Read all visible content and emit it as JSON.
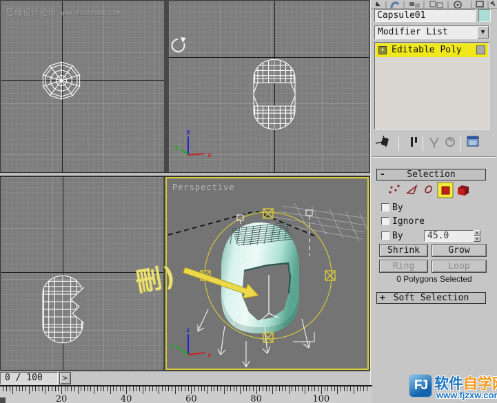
{
  "watermark": {
    "title": "思缘设计论坛",
    "url": "WWW.MISSYUAN.COM"
  },
  "viewports": {
    "perspective_label": "Perspective",
    "annotation": "刪)",
    "axis_labels": {
      "x": "x",
      "y": "y",
      "z": "z"
    }
  },
  "command_panel": {
    "object_name": "Capsule01",
    "object_color": "#a9ddd5",
    "modifier_dropdown": "Modifier List",
    "stack_item": "Editable Poly",
    "stack_expand_glyph": "+",
    "selection_rollout": {
      "title": "Selection",
      "collapse_glyph": "-",
      "sub_object_modes": [
        "vertex",
        "edge",
        "border",
        "polygon",
        "element"
      ],
      "active_mode": "polygon",
      "checkbox_by_vertex": "By",
      "checkbox_ignore": "Ignore",
      "checkbox_by_angle": "By",
      "angle_value": "45.0",
      "shrink": "Shrink",
      "grow": "Grow",
      "ring": "Ring",
      "loop": "Loop",
      "status": "0 Polygons Selected"
    },
    "soft_selection_rollout": {
      "title": "Soft Selection",
      "expand_glyph": "+"
    }
  },
  "timeline": {
    "frame_indicator": "0 / 100",
    "next_button": ">",
    "ruler_labels": [
      "20",
      "40",
      "60",
      "80",
      "100"
    ]
  },
  "logo": {
    "initials": "FJ",
    "name_blue": "软件",
    "name_orange": "自学网",
    "url": "www.fjzxw.com"
  }
}
